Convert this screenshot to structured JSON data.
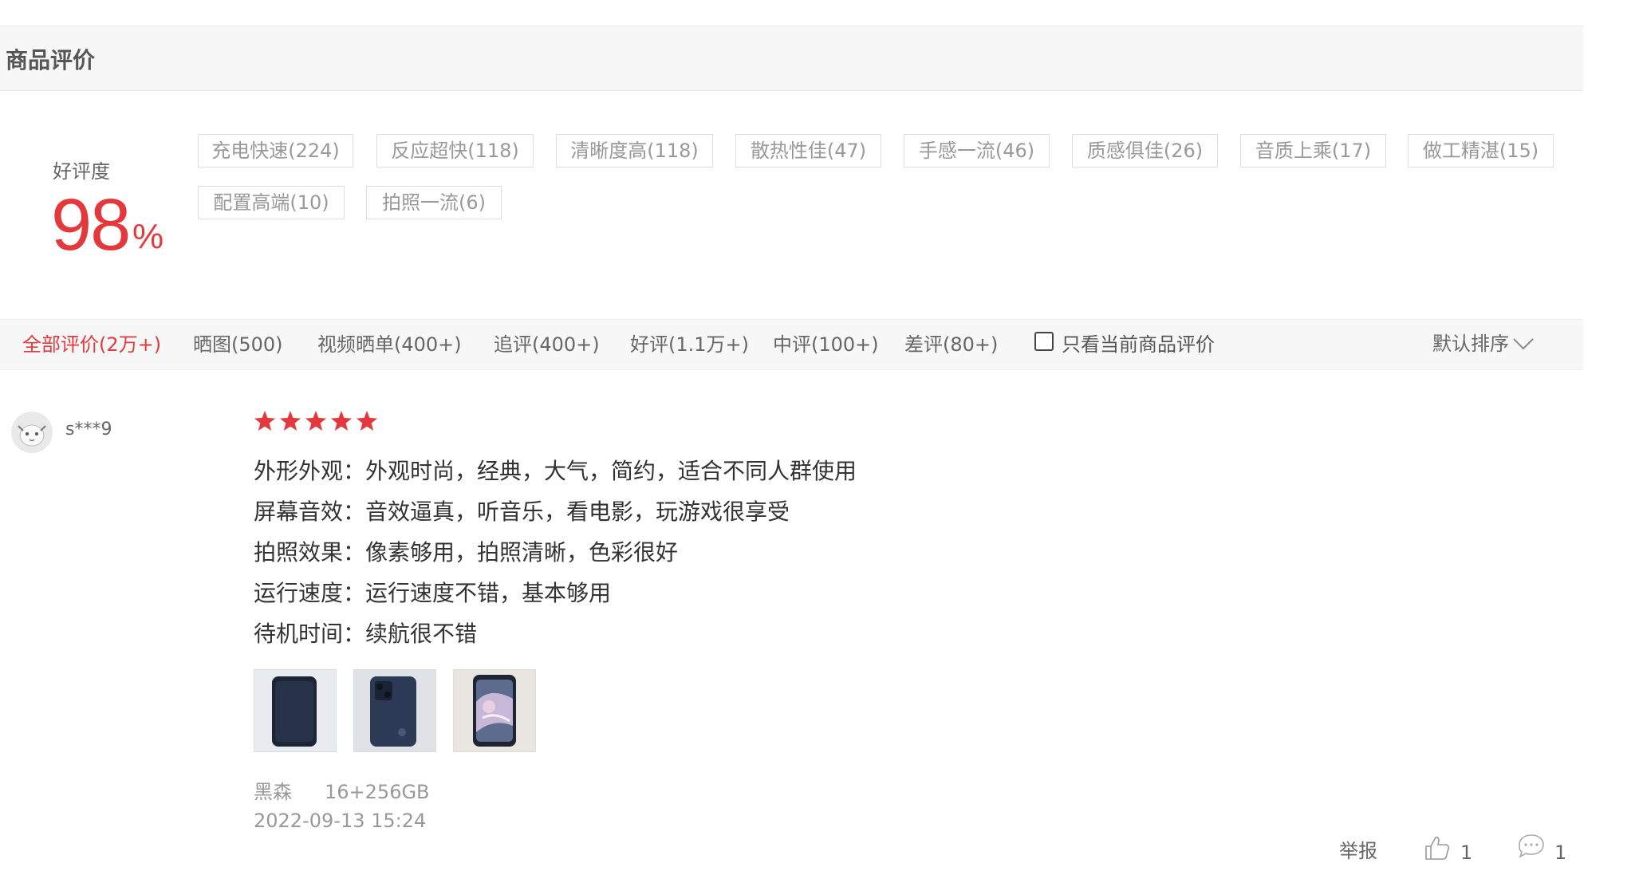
{
  "section": {
    "title": "商品评价"
  },
  "rating": {
    "label": "好评度",
    "value": "98",
    "unit": "%"
  },
  "tags": [
    "充电快速(224)",
    "反应超快(118)",
    "清晰度高(118)",
    "散热性佳(47)",
    "手感一流(46)",
    "质感俱佳(26)",
    "音质上乘(17)",
    "做工精湛(15)",
    "配置高端(10)",
    "拍照一流(6)"
  ],
  "filters": {
    "tabs": [
      "全部评价(2万+)",
      "晒图(500)",
      "视频晒单(400+)",
      "追评(400+)",
      "好评(1.1万+)",
      "中评(100+)",
      "差评(80+)"
    ],
    "active_index": 0,
    "only_current": {
      "label": "只看当前商品评价",
      "checked": false
    },
    "sort": {
      "label": "默认排序"
    }
  },
  "review": {
    "user": "s***9",
    "stars": 5,
    "lines": [
      "外形外观：外观时尚，经典，大气，简约，适合不同人群使用",
      "屏幕音效：音效逼真，听音乐，看电影，玩游戏很享受",
      "拍照效果：像素够用，拍照清晰，色彩很好",
      "运行速度：运行速度不错，基本够用",
      "待机时间：续航很不错"
    ],
    "variant": {
      "color": "黑森",
      "spec": "16+256GB"
    },
    "date": "2022-09-13 15:24",
    "actions": {
      "report": "举报",
      "likes": "1",
      "comments": "1"
    }
  },
  "colors": {
    "accent": "#e4393c",
    "star": "#e4393c",
    "tag_text": "#999999"
  }
}
